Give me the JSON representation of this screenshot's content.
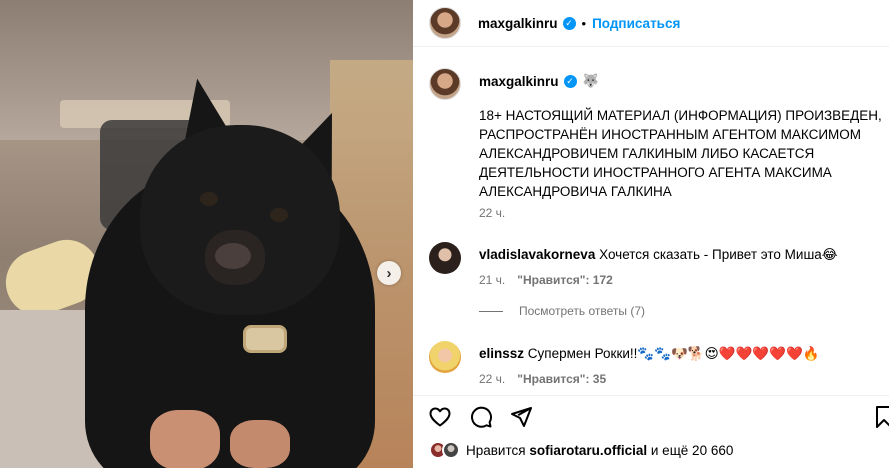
{
  "header": {
    "username": "maxgalkinru",
    "separator": "•",
    "follow_label": "Подписаться",
    "verified_glyph": "✓"
  },
  "caption": {
    "username": "maxgalkinru",
    "emoji": "🐺",
    "text": "18+ НАСТОЯЩИЙ МАТЕРИАЛ (ИНФОРМАЦИЯ) ПРОИЗВЕДЕН, РАСПРОСТРАНЁН ИНОСТРАННЫМ АГЕНТОМ МАКСИМОМ АЛЕКСАНДРОВИЧЕМ ГАЛКИНЫМ ЛИБО КАСАЕТСЯ ДЕЯТЕЛЬНОСТИ ИНОСТРАННОГО АГЕНТА МАКСИМА АЛЕКСАНДРОВИЧА ГАЛКИНА",
    "time": "22 ч."
  },
  "comments": [
    {
      "username": "vladislavakorneva",
      "text": "Хочется сказать - Привет это Миша😂",
      "time": "21 ч.",
      "likes": "\"Нравится\": 172"
    },
    {
      "username": "elinssz",
      "text": "Супермен Рокки!!🐾🐾🐶🐕😍❤️❤️❤️❤️❤️🔥",
      "time": "22 ч.",
      "likes": "\"Нравится\": 35"
    }
  ],
  "view_replies_label": "Посмотреть ответы (7)",
  "carousel": {
    "next_glyph": "›"
  },
  "likes_line": {
    "prefix": "Нравится",
    "user": "sofiarotaru.official",
    "suffix": "и ещё 20 660"
  },
  "icons": [
    "heart-icon",
    "comment-icon",
    "share-icon",
    "bookmark-icon"
  ],
  "colors": {
    "accent": "#0095f6",
    "muted": "#737373"
  }
}
